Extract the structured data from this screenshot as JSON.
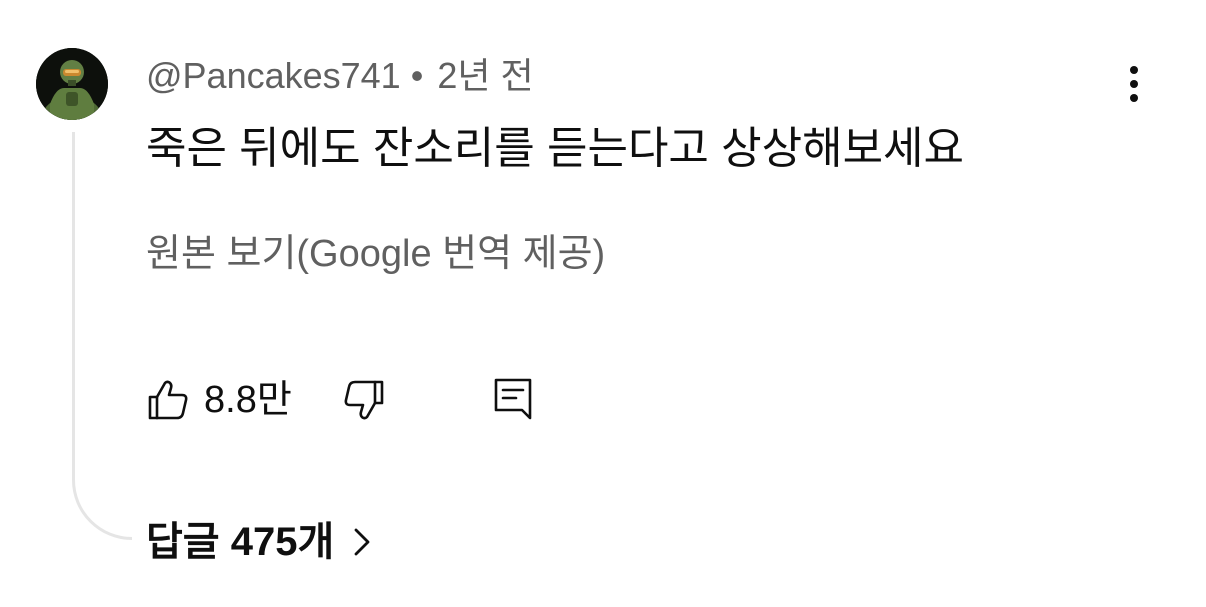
{
  "comment": {
    "author": "@Pancakes741",
    "separator": "•",
    "time": "2년 전",
    "text": "죽은 뒤에도 잔소리를 듣는다고 상상해보세요",
    "translate_link": "원본 보기(Google 번역 제공)",
    "like_count": "8.8만",
    "replies_label": "답글 475개"
  },
  "icons": {
    "avatar": "armored-soldier-avatar",
    "more": "vertical-ellipsis-icon",
    "like": "thumbs-up-icon",
    "dislike": "thumbs-down-icon",
    "reply": "comment-reply-icon",
    "expand": "chevron-right-icon"
  },
  "colors": {
    "text_primary": "#0f0f0f",
    "text_secondary": "#606060",
    "thread_line": "#e5e5e5",
    "background": "#ffffff"
  }
}
